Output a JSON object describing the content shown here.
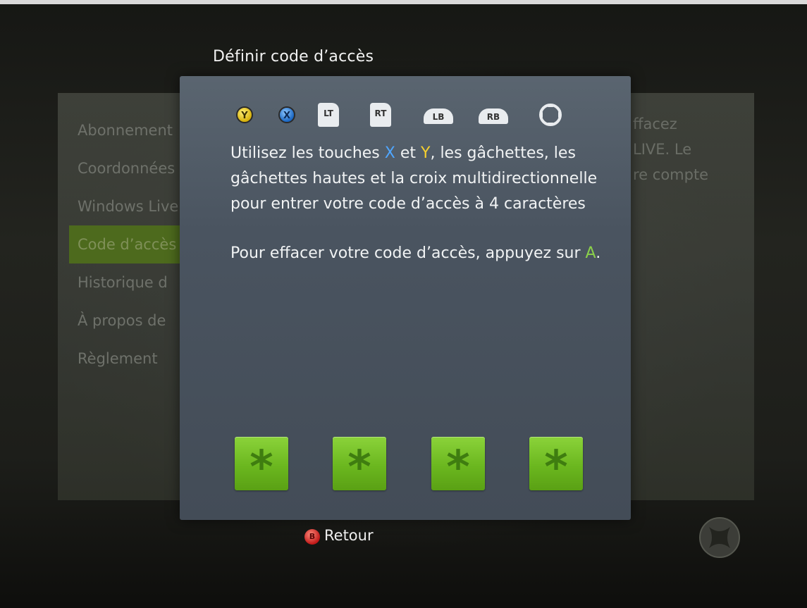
{
  "dialog": {
    "title": "Définir code d’accès",
    "buttons": [
      {
        "name": "y-button-icon",
        "label": "Y"
      },
      {
        "name": "x-button-icon",
        "label": "X"
      },
      {
        "name": "lt-trigger-icon",
        "label": "LT"
      },
      {
        "name": "rt-trigger-icon",
        "label": "RT"
      },
      {
        "name": "lb-bumper-icon",
        "label": "LB"
      },
      {
        "name": "rb-bumper-icon",
        "label": "RB"
      },
      {
        "name": "dpad-icon",
        "label": ""
      }
    ],
    "instructions": {
      "p1_a": "Utilisez les touches ",
      "p1_x": "X",
      "p1_b": " et ",
      "p1_y": "Y",
      "p1_c": ", les gâchettes, les gâchettes hautes et la croix multidirectionnelle pour entrer votre code d’accès à 4 caractères",
      "p2_a": "Pour effacer votre code d’accès, appuyez sur ",
      "p2_btn": "A",
      "p2_b": "."
    },
    "code_slots": [
      "*",
      "*",
      "*",
      "*"
    ]
  },
  "background_menu": {
    "items": [
      "Abonnement",
      "Coordonnées",
      "Windows Live",
      "Code d’accès",
      "Historique d",
      "À propos de",
      "Règlement"
    ],
    "selected_index": 3,
    "description_lines": [
      "ffacez",
      "LIVE. Le",
      "re compte"
    ]
  },
  "footer": {
    "back_button_glyph": "B",
    "back_label": "Retour"
  },
  "colors": {
    "accent_green": "#6bb71f",
    "x_blue": "#1a66c2",
    "y_yellow": "#d7b10a",
    "b_red": "#c01818"
  }
}
